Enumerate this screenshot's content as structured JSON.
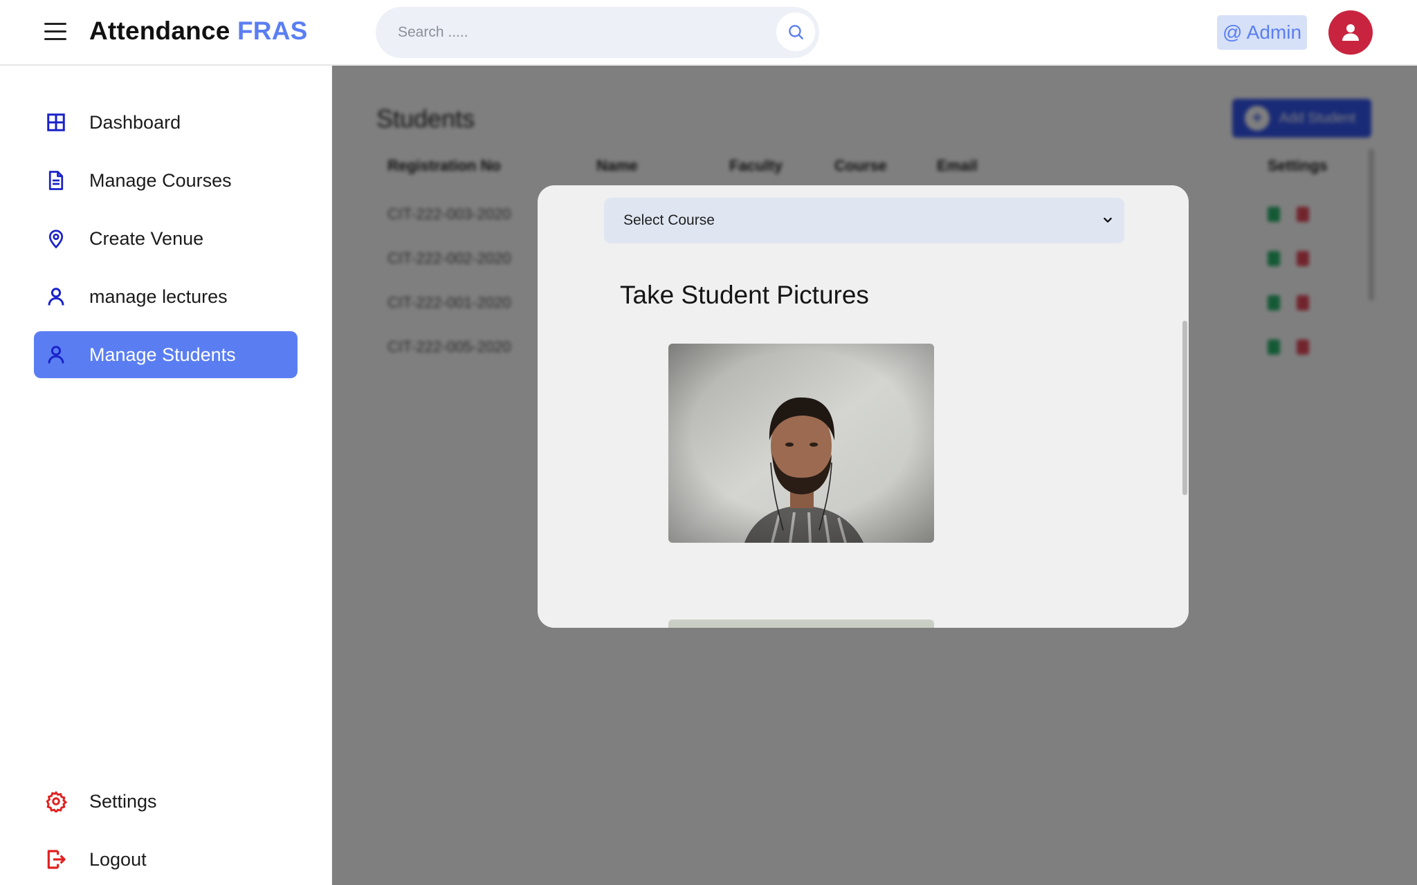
{
  "header": {
    "menu_icon": "hamburger-menu-icon",
    "logo_main": "Attendance",
    "logo_accent": "FRAS",
    "search_placeholder": "Search .....",
    "search_icon": "search-icon",
    "admin_label": "@ Admin",
    "avatar_icon": "user-icon"
  },
  "sidebar": {
    "items": [
      {
        "label": "Dashboard",
        "icon": "grid-icon"
      },
      {
        "label": "Manage Courses",
        "icon": "document-icon"
      },
      {
        "label": "Create Venue",
        "icon": "location-pin-icon"
      },
      {
        "label": "manage lectures",
        "icon": "user-icon"
      },
      {
        "label": "Manage Students",
        "icon": "user-icon",
        "active": true
      }
    ],
    "bottom_items": [
      {
        "label": "Settings",
        "icon": "gear-icon"
      },
      {
        "label": "Logout",
        "icon": "logout-icon"
      }
    ]
  },
  "main": {
    "title": "Students",
    "add_button_label": "Add Student",
    "columns": [
      "Registration No",
      "Name",
      "Faculty",
      "Course",
      "Email",
      "Settings"
    ],
    "rows": [
      {
        "reg_no": "CIT-222-003-2020"
      },
      {
        "reg_no": "CIT-222-002-2020"
      },
      {
        "reg_no": "CIT-222-001-2020"
      },
      {
        "reg_no": "CIT-222-005-2020"
      }
    ]
  },
  "modal": {
    "select_course": "Select Course",
    "title": "Take Student Pictures"
  },
  "colors": {
    "accent": "#5a7ef2",
    "nav_icon": "#1a22c9",
    "danger_icon": "#e0201f",
    "avatar_bg": "#c9243f",
    "overlay": "rgba(0,0,0,0.5)"
  }
}
